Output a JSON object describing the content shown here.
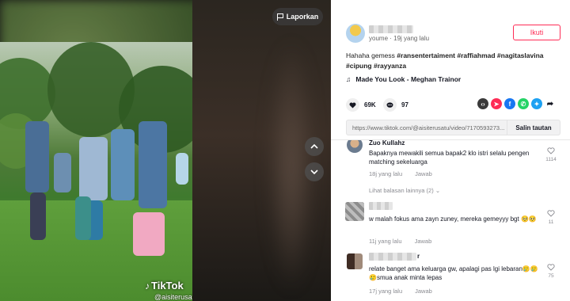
{
  "report": {
    "label": "Laporkan"
  },
  "watermark": {
    "logo": "TikTok",
    "user": "@aisiterusatu"
  },
  "post": {
    "author_meta": "youme · 19j yang lalu",
    "follow_label": "Ikuti",
    "caption_text": "Hahaha gemess",
    "hashtags": [
      "#ransentertaiment",
      "#raffiahmad",
      "#nagitaslavina",
      "#cipung",
      "#rayyanza"
    ],
    "music": "Made You Look - Meghan Trainor",
    "likes": "69K",
    "comments_count": "97",
    "link_url": "https://www.tiktok.com/@aisiterusatu/video/7170593273...",
    "copy_label": "Salin tautan"
  },
  "icons": {
    "report": "flag-icon",
    "nav_up": "chevron-up-icon",
    "nav_down": "chevron-down-icon",
    "music": "music-note-icon",
    "like": "heart-icon",
    "comment": "comment-icon",
    "share": [
      "embed-icon",
      "tiktok-share-icon",
      "facebook-icon",
      "whatsapp-icon",
      "twitter-icon",
      "share-arrow-icon"
    ]
  },
  "colors": {
    "accent": "#fe2c55",
    "facebook": "#1877f2",
    "whatsapp": "#25d366",
    "twitter": "#1da1f2",
    "embed": "#3a3a3a"
  },
  "comments": [
    {
      "name": "Zuo Kullahz",
      "text": "Bapaknya mewakili semua bapak2 klo istri selalu pengen matching sekeluarga",
      "time": "18j yang lalu",
      "reply": "Jawab",
      "likes": "1114",
      "more_replies": "Lihat balasan lainnya (2)"
    },
    {
      "name": "",
      "text": "w malah fokus ama zayn zuney, mereka gemeyyy bgt 🥺🥺",
      "time": "11j yang lalu",
      "reply": "Jawab",
      "likes": "11"
    },
    {
      "name": "r",
      "text": "relate banget ama keluarga gw, apalagi pas lgi lebaran🥲🥲🥲smua anak minta lepas",
      "time": "17j yang lalu",
      "reply": "Jawab",
      "likes": "75"
    }
  ]
}
